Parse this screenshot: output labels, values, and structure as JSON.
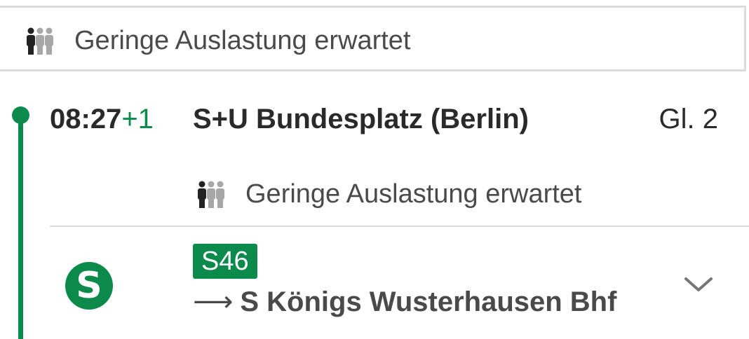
{
  "top_card": {
    "occupancy_text": "Geringe Auslastung erwartet",
    "icon": "people-occupancy-icon"
  },
  "stop": {
    "time": "08:27",
    "delay": "+1",
    "station": "S+U Bundesplatz (Berlin)",
    "platform": "Gl. 2",
    "occupancy_text": "Geringe Auslastung erwartet",
    "occupancy_icon": "people-occupancy-icon"
  },
  "journey": {
    "mode_icon": "s-bahn-icon",
    "mode_symbol": "S",
    "line": "S46",
    "direction_arrow": "⟶",
    "destination": "S Königs Wusterhausen Bhf",
    "expand_icon": "chevron-down-icon"
  },
  "colors": {
    "accent": "#0b8a4b",
    "text": "#2a2a2a",
    "muted": "#4a4a4a",
    "divider": "#dcdcdc"
  }
}
